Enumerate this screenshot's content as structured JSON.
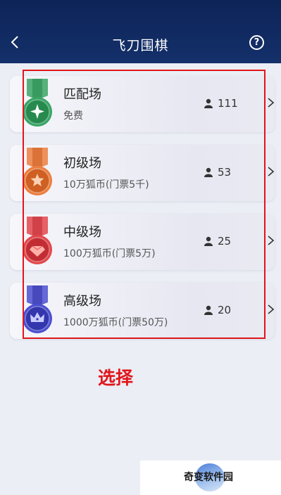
{
  "header": {
    "title": "飞刀围棋",
    "help_label": "?"
  },
  "rooms": [
    {
      "name": "匹配场",
      "fee": "免费",
      "players": "111",
      "medal_color": "#3aa565",
      "medal_dark": "#268a4e",
      "emblem": "sparkle-icon"
    },
    {
      "name": "初级场",
      "fee": "10万狐币(门票5千)",
      "players": "53",
      "medal_color": "#ec7e3e",
      "medal_dark": "#cf5f22",
      "emblem": "star-icon"
    },
    {
      "name": "中级场",
      "fee": "100万狐币(门票5万)",
      "players": "25",
      "medal_color": "#e3474b",
      "medal_dark": "#c22d34",
      "emblem": "gem-icon"
    },
    {
      "name": "高级场",
      "fee": "1000万狐币(门票50万)",
      "players": "20",
      "medal_color": "#4b4fd0",
      "medal_dark": "#3336ac",
      "emblem": "crown-icon"
    }
  ],
  "annotation": {
    "label": "选择",
    "color": "#e0151b"
  },
  "watermark": {
    "text": "奇变软件园"
  }
}
